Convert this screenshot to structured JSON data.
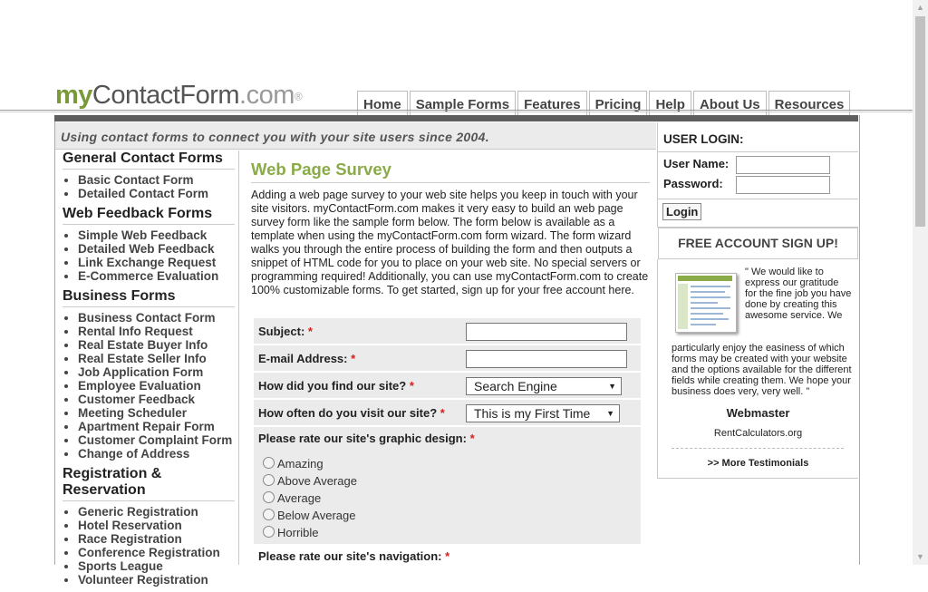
{
  "logo": {
    "my": "my",
    "contact": "ContactForm",
    "dotcom": ".com",
    "reg": "®"
  },
  "nav": [
    "Home",
    "Sample Forms",
    "Features",
    "Pricing",
    "Help",
    "About Us",
    "Resources"
  ],
  "tagline": "Using contact forms to connect you with your site users since 2004.",
  "sidebar": {
    "sections": [
      {
        "title": "General Contact Forms",
        "items": [
          "Basic Contact Form",
          "Detailed Contact Form"
        ]
      },
      {
        "title": "Web Feedback Forms",
        "items": [
          "Simple Web Feedback",
          "Detailed Web Feedback",
          "Link Exchange Request",
          "E-Commerce Evaluation"
        ]
      },
      {
        "title": "Business Forms",
        "items": [
          "Business Contact Form",
          "Rental Info Request",
          "Real Estate Buyer Info",
          "Real Estate Seller Info",
          "Job Application Form",
          "Employee Evaluation",
          "Customer Feedback",
          "Meeting Scheduler",
          "Apartment Repair Form",
          "Customer Complaint Form",
          "Change of Address"
        ]
      },
      {
        "title": "Registration & Reservation",
        "items": [
          "Generic Registration",
          "Hotel Reservation",
          "Race Registration",
          "Conference Registration",
          "Sports League",
          "Volunteer Registration"
        ]
      }
    ]
  },
  "main": {
    "title": "Web Page Survey",
    "intro": "Adding a web page survey to your web site helps you keep in touch with your site visitors. myContactForm.com makes it very easy to build an web page survey form like the sample form below. The form below is available as a template when using the myContactForm.com form wizard. The form wizard walks you through the entire process of building the form and then outputs a snippet of HTML code for you to place on your web site. No special servers or programming required! Additionally, you can use myContactForm.com to create 100% customizable forms. To get started, sign up for your free account here."
  },
  "form": {
    "subject_label": "Subject:",
    "email_label": "E-mail Address:",
    "find_label": "How did you find our site?",
    "find_value": "Search Engine",
    "often_label": "How often do you visit our site?",
    "often_value": "This is my First Time",
    "design_label": "Please rate our site's graphic design:",
    "design_options": [
      "Amazing",
      "Above Average",
      "Average",
      "Below Average",
      "Horrible"
    ],
    "nav_label": "Please rate our site's navigation:",
    "required_mark": "*"
  },
  "login": {
    "title": "USER LOGIN:",
    "username_label": "User Name:",
    "password_label": "Password:",
    "button": "Login"
  },
  "signup": "FREE ACCOUNT SIGN UP!",
  "testimonial": {
    "quote_part1": "\" We would like to express our gratitude for the fine job you have done by creating this awesome service. We",
    "quote_part2": "particularly enjoy the easiness of which forms may be created with your website and the options available for the different fields while creating them. We hope your business does very, very well. \"",
    "author": "Webmaster",
    "site": "RentCalculators.org",
    "more": ">> More Testimonials"
  }
}
